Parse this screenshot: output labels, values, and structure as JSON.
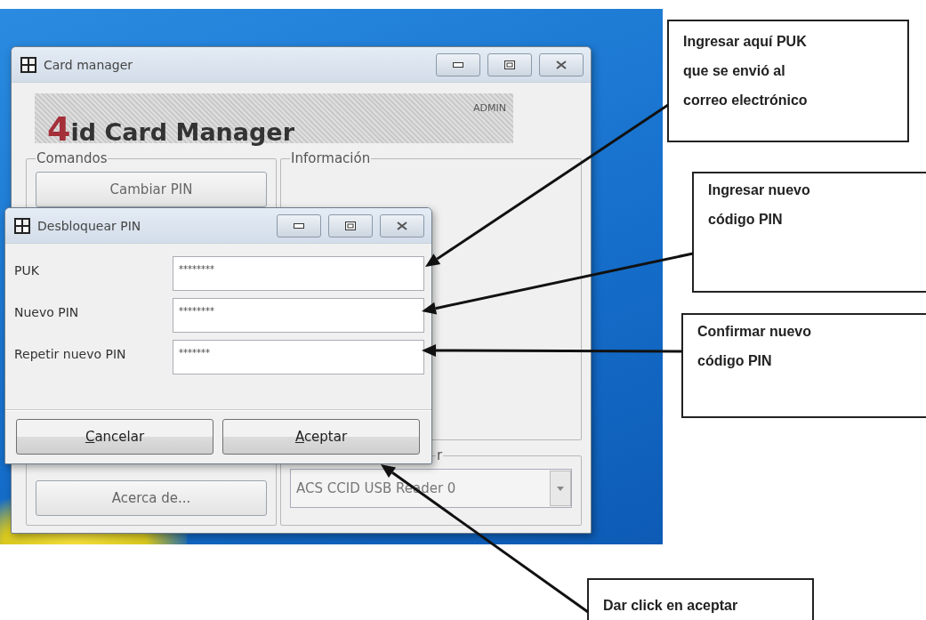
{
  "desktop": {
    "main_window": {
      "title": "Card manager",
      "banner": {
        "logo": "4id Card Manager",
        "role": "ADMIN"
      },
      "groups": [
        {
          "kind": "commands",
          "title": "Comandos",
          "buttons": [
            "Cambiar PIN",
            "Acerca de..."
          ]
        },
        {
          "kind": "info",
          "title": "Información"
        },
        {
          "kind": "reader",
          "title": "r",
          "select_value": "ACS CCID USB Reader 0"
        }
      ]
    },
    "dialog": {
      "title": "Desbloquear PIN",
      "fields": [
        {
          "label": "PUK",
          "value": "********"
        },
        {
          "label": "Nuevo PIN",
          "value": "********"
        },
        {
          "label": "Repetir nuevo PIN",
          "value": "*******"
        }
      ],
      "buttons": [
        "Cancelar",
        "Aceptar"
      ]
    }
  },
  "callouts": [
    {
      "text": "Ingresar aquí PUK que se envió al correo electrónico"
    },
    {
      "text": "Ingresar nuevo código PIN"
    },
    {
      "text": "Confirmar nuevo código PIN"
    },
    {
      "text": "Dar click en aceptar"
    }
  ]
}
